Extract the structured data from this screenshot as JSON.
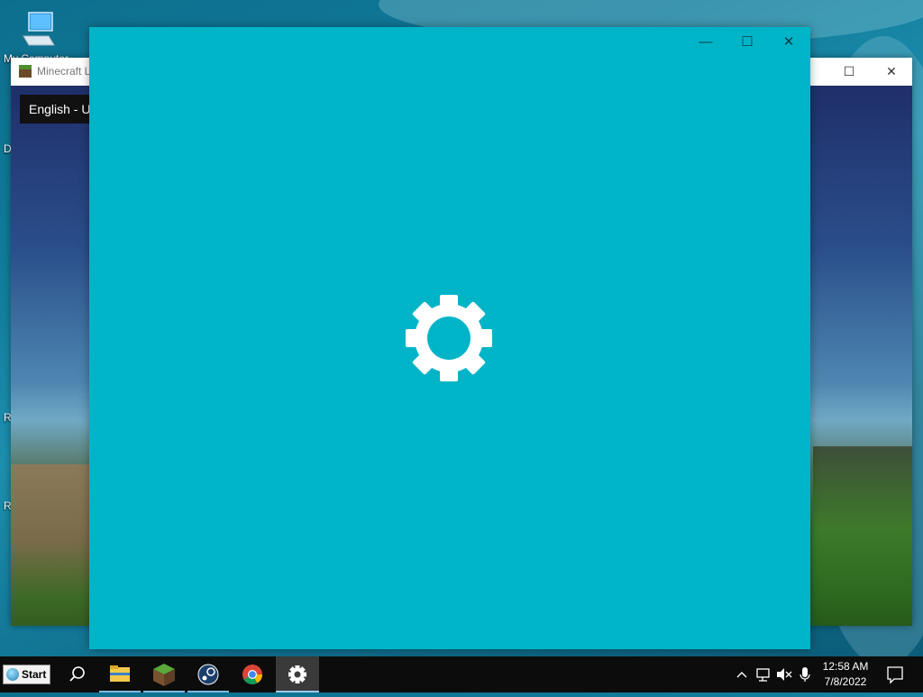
{
  "desktop": {
    "icons": [
      {
        "label": "My Computer",
        "icon": "computer-icon"
      },
      {
        "label": "D",
        "icon": "desktop-item"
      },
      {
        "label": "R",
        "icon": "desktop-item"
      },
      {
        "label": "R",
        "icon": "desktop-item"
      }
    ]
  },
  "minecraft_window": {
    "title": "Minecraft L",
    "language": "English - U",
    "controls": {
      "minimize": "—",
      "maximize": "☐",
      "close": "✕"
    }
  },
  "settings_window": {
    "icon": "gear-icon",
    "controls": {
      "minimize": "—",
      "maximize": "☐",
      "close": "✕"
    },
    "background_color": "#00b4c8"
  },
  "taskbar": {
    "start_label": "Start",
    "apps": [
      {
        "name": "search",
        "icon": "search-icon"
      },
      {
        "name": "file-explorer",
        "icon": "folder-icon"
      },
      {
        "name": "minecraft",
        "icon": "minecraft-icon"
      },
      {
        "name": "steam",
        "icon": "steam-icon"
      },
      {
        "name": "chrome",
        "icon": "chrome-icon"
      },
      {
        "name": "settings",
        "icon": "gear-icon"
      }
    ],
    "clock": {
      "time": "12:58 AM",
      "date": "7/8/2022"
    }
  }
}
